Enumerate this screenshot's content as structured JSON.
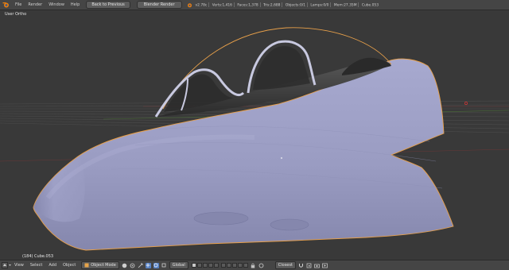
{
  "top_bar": {
    "menus": [
      "File",
      "Render",
      "Window",
      "Help"
    ],
    "back_button": "Back to Previous",
    "render_engine": "Blender Render",
    "stats": [
      "v2.78c",
      "Verts:1,416",
      "Faces:1,378",
      "Tris:2,688",
      "Objects:0/1",
      "Lamps:0/0",
      "Mem:27.35M",
      "Cube.053"
    ],
    "editor_title": "Object Mode"
  },
  "viewport": {
    "view_label": "User Ortho",
    "object_label": "(184) Cube.053"
  },
  "bottom_bar": {
    "menus": [
      "View",
      "Select",
      "Add",
      "Object"
    ],
    "mode": "Object Mode",
    "orientation": "Global",
    "proportional": "Closest"
  },
  "colors": {
    "header": "#454545",
    "viewport": "#393939",
    "mesh": "#9d9fc4",
    "selection_outline": "#e8a04a"
  }
}
